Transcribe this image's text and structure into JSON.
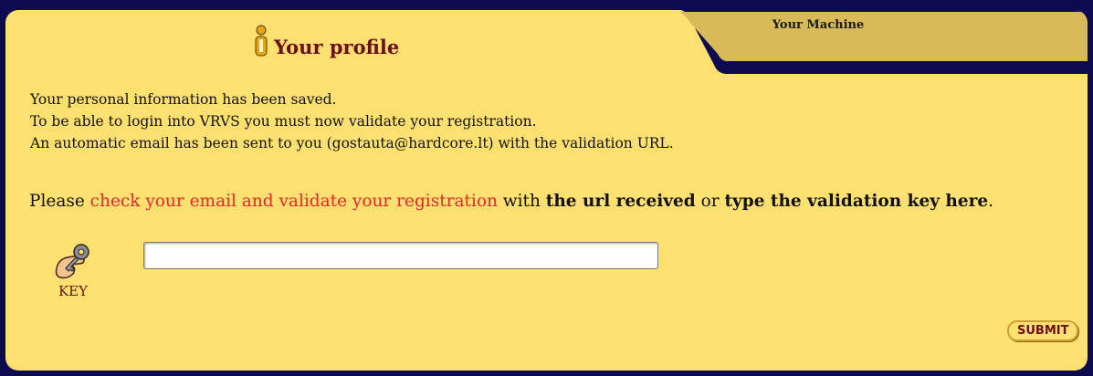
{
  "tabs": {
    "active": {
      "label": "Your profile",
      "icon": "info-person-icon"
    },
    "inactive": {
      "label": "Your Machine"
    }
  },
  "messages": [
    "Your personal information has been saved.",
    "To be able to login into VRVS you must now validate your registration.",
    "An automatic email has been sent to you (gostauta@hardcore.lt) with the validation URL."
  ],
  "instruction": {
    "part1": "Please ",
    "part2": "check your email and validate your registration",
    "part3": " with ",
    "part4": "the url received",
    "part5": " or ",
    "part6": "type the validation key here",
    "part7": "."
  },
  "key": {
    "label": "KEY",
    "icon": "key-hand-icon",
    "value": "",
    "placeholder": ""
  },
  "submit_label": "SUBMIT",
  "colors": {
    "panel_bg": "#fde070",
    "frame": "#0d0a4f",
    "title": "#6b0f1a",
    "highlight": "#e8262b"
  }
}
